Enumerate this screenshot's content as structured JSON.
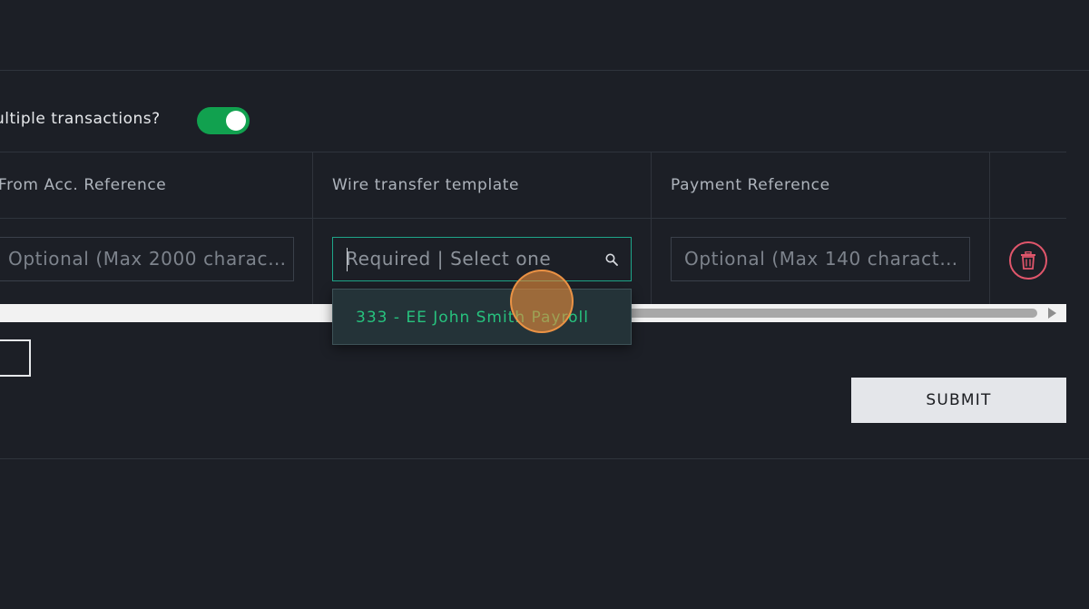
{
  "multi": {
    "label": "ultiple transactions?",
    "toggle_on": true
  },
  "table": {
    "headers": [
      "From Acc. Reference",
      "Wire transfer template",
      "Payment Reference"
    ],
    "row": {
      "from_acc_placeholder": "Optional (Max 2000 charac…",
      "template_placeholder": "Required | Select one",
      "payment_ref_placeholder": "Optional (Max 140 charact…"
    }
  },
  "dropdown": {
    "options": [
      "333 - EE John Smith Payroll"
    ]
  },
  "submit_label": "SUBMIT",
  "colors": {
    "background": "#1c1f26",
    "toggle_on": "#11a14f",
    "focus_border": "#1ea589",
    "option_text": "#27c27e",
    "delete_accent": "#e0566b",
    "submit_bg": "#e4e6ea"
  },
  "icons": [
    "search-icon",
    "trash-icon",
    "scroll-right-arrow-icon"
  ]
}
